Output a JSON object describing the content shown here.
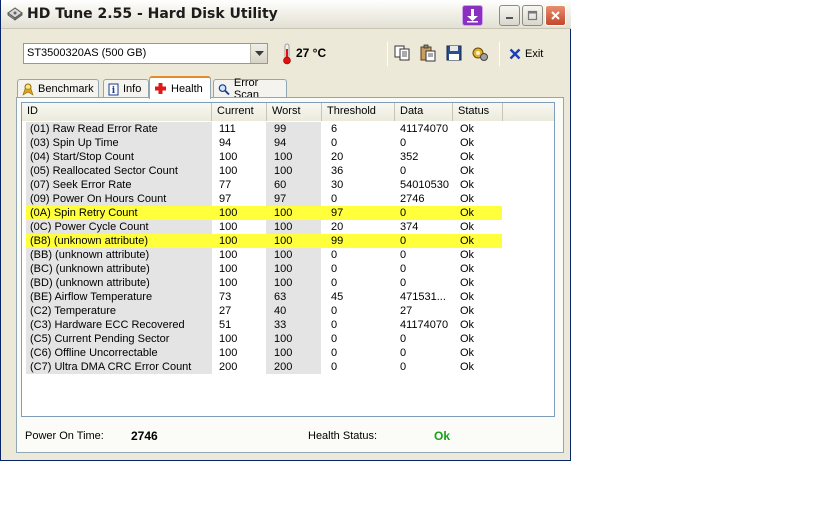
{
  "window": {
    "title": "HD Tune 2.55 - Hard Disk Utility"
  },
  "toolbar": {
    "drive": "ST3500320AS (500 GB)",
    "temperature": "27 °C",
    "exit_label": "Exit"
  },
  "tabs": [
    {
      "label": "Benchmark",
      "icon": "benchmark-icon"
    },
    {
      "label": "Info",
      "icon": "info-icon"
    },
    {
      "label": "Health",
      "icon": "health-cross-icon",
      "active": true
    },
    {
      "label": "Error Scan",
      "icon": "magnifier-icon"
    }
  ],
  "table": {
    "columns": [
      "ID",
      "Current",
      "Worst",
      "Threshold",
      "Data",
      "Status"
    ],
    "rows": [
      {
        "id": "(01) Raw Read Error Rate",
        "current": "111",
        "worst": "99",
        "threshold": "6",
        "data": "41174070",
        "status": "Ok",
        "highlight": false
      },
      {
        "id": "(03) Spin Up Time",
        "current": "94",
        "worst": "94",
        "threshold": "0",
        "data": "0",
        "status": "Ok",
        "highlight": false
      },
      {
        "id": "(04) Start/Stop Count",
        "current": "100",
        "worst": "100",
        "threshold": "20",
        "data": "352",
        "status": "Ok",
        "highlight": false
      },
      {
        "id": "(05) Reallocated Sector Count",
        "current": "100",
        "worst": "100",
        "threshold": "36",
        "data": "0",
        "status": "Ok",
        "highlight": false
      },
      {
        "id": "(07) Seek Error Rate",
        "current": "77",
        "worst": "60",
        "threshold": "30",
        "data": "54010530",
        "status": "Ok",
        "highlight": false
      },
      {
        "id": "(09) Power On Hours Count",
        "current": "97",
        "worst": "97",
        "threshold": "0",
        "data": "2746",
        "status": "Ok",
        "highlight": false
      },
      {
        "id": "(0A) Spin Retry Count",
        "current": "100",
        "worst": "100",
        "threshold": "97",
        "data": "0",
        "status": "Ok",
        "highlight": true
      },
      {
        "id": "(0C) Power Cycle Count",
        "current": "100",
        "worst": "100",
        "threshold": "20",
        "data": "374",
        "status": "Ok",
        "highlight": false
      },
      {
        "id": "(B8) (unknown attribute)",
        "current": "100",
        "worst": "100",
        "threshold": "99",
        "data": "0",
        "status": "Ok",
        "highlight": true
      },
      {
        "id": "(BB) (unknown attribute)",
        "current": "100",
        "worst": "100",
        "threshold": "0",
        "data": "0",
        "status": "Ok",
        "highlight": false
      },
      {
        "id": "(BC) (unknown attribute)",
        "current": "100",
        "worst": "100",
        "threshold": "0",
        "data": "0",
        "status": "Ok",
        "highlight": false
      },
      {
        "id": "(BD) (unknown attribute)",
        "current": "100",
        "worst": "100",
        "threshold": "0",
        "data": "0",
        "status": "Ok",
        "highlight": false
      },
      {
        "id": "(BE) Airflow Temperature",
        "current": "73",
        "worst": "63",
        "threshold": "45",
        "data": "471531...",
        "status": "Ok",
        "highlight": false
      },
      {
        "id": "(C2) Temperature",
        "current": "27",
        "worst": "40",
        "threshold": "0",
        "data": "27",
        "status": "Ok",
        "highlight": false
      },
      {
        "id": "(C3) Hardware ECC Recovered",
        "current": "51",
        "worst": "33",
        "threshold": "0",
        "data": "41174070",
        "status": "Ok",
        "highlight": false
      },
      {
        "id": "(C5) Current Pending Sector",
        "current": "100",
        "worst": "100",
        "threshold": "0",
        "data": "0",
        "status": "Ok",
        "highlight": false
      },
      {
        "id": "(C6) Offline Uncorrectable",
        "current": "100",
        "worst": "100",
        "threshold": "0",
        "data": "0",
        "status": "Ok",
        "highlight": false
      },
      {
        "id": "(C7) Ultra DMA CRC Error Count",
        "current": "200",
        "worst": "200",
        "threshold": "0",
        "data": "0",
        "status": "Ok",
        "highlight": false
      }
    ]
  },
  "status": {
    "power_on_label": "Power On Time:",
    "power_on_value": "2746",
    "health_label": "Health Status:",
    "health_value": "Ok",
    "health_color": "#19a019"
  },
  "colors": {
    "highlight": "#ffff3c",
    "title_text": "#1c1c1c"
  }
}
